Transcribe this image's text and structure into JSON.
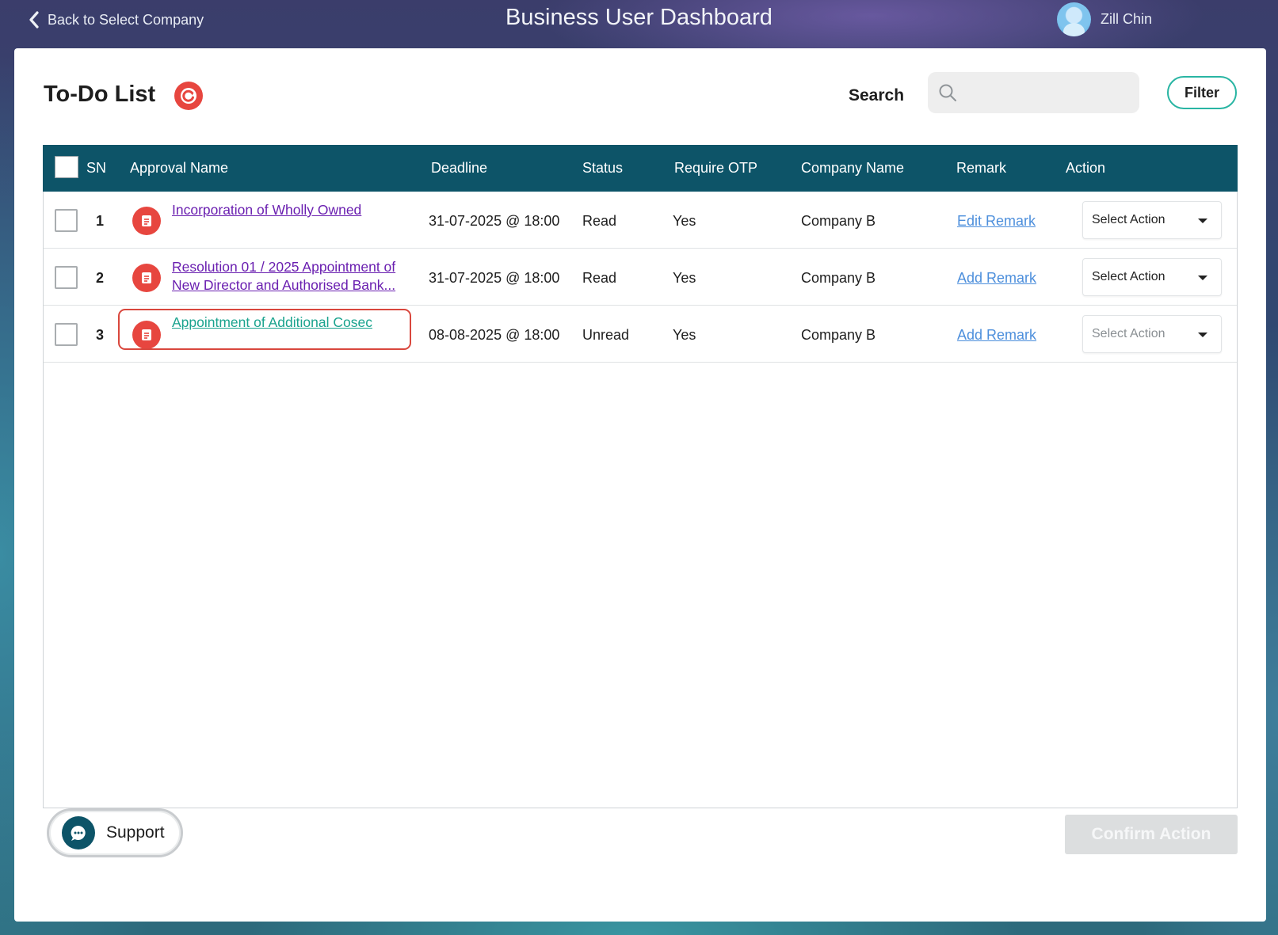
{
  "topbar": {
    "back_label": "Back to Select Company",
    "title": "Business User Dashboard",
    "user_name": "Zill Chin"
  },
  "todo": {
    "title": "To-Do List",
    "search_label": "Search",
    "search_placeholder": "",
    "filter_label": "Filter"
  },
  "table": {
    "headers": {
      "sn": "SN",
      "approval_name": "Approval Name",
      "deadline": "Deadline",
      "status": "Status",
      "require_otp": "Require OTP",
      "company_name": "Company Name",
      "remark": "Remark",
      "action": "Action"
    },
    "rows": [
      {
        "sn": "1",
        "approval_name_line1": "Incorporation of Wholly Owned",
        "approval_name_line2": "",
        "deadline": "31-07-2025 @ 18:00",
        "status": "Read",
        "require_otp": "Yes",
        "company_name": "Company B",
        "remark": "Edit Remark",
        "action": "Select Action"
      },
      {
        "sn": "2",
        "approval_name_line1": "Resolution 01 / 2025 Appointment of",
        "approval_name_line2": "New Director and Authorised Bank...",
        "deadline": "31-07-2025 @ 18:00",
        "status": "Read",
        "require_otp": "Yes",
        "company_name": "Company B",
        "remark": "Add Remark",
        "action": "Select Action"
      },
      {
        "sn": "3",
        "approval_name_line1": "Appointment of Additional Cosec",
        "approval_name_line2": "",
        "deadline": "08-08-2025 @ 18:00",
        "status": "Unread",
        "require_otp": "Yes",
        "company_name": "Company B",
        "remark": "Add Remark",
        "action": "Select Action"
      }
    ]
  },
  "footer": {
    "support_label": "Support",
    "confirm_label": "Confirm Action"
  },
  "colors": {
    "header_bg": "#0d5468",
    "accent_red": "#e7463f",
    "accent_teal": "#29b5a3",
    "link_purple": "#6a1fb0",
    "link_blue": "#4d8fdc",
    "highlight": "#d9473d"
  },
  "icons": {
    "back": "chevron-left-icon",
    "refresh": "refresh-icon",
    "search": "search-icon",
    "document": "document-icon",
    "dropdown": "caret-down-icon",
    "support": "chat-bubble-icon"
  }
}
